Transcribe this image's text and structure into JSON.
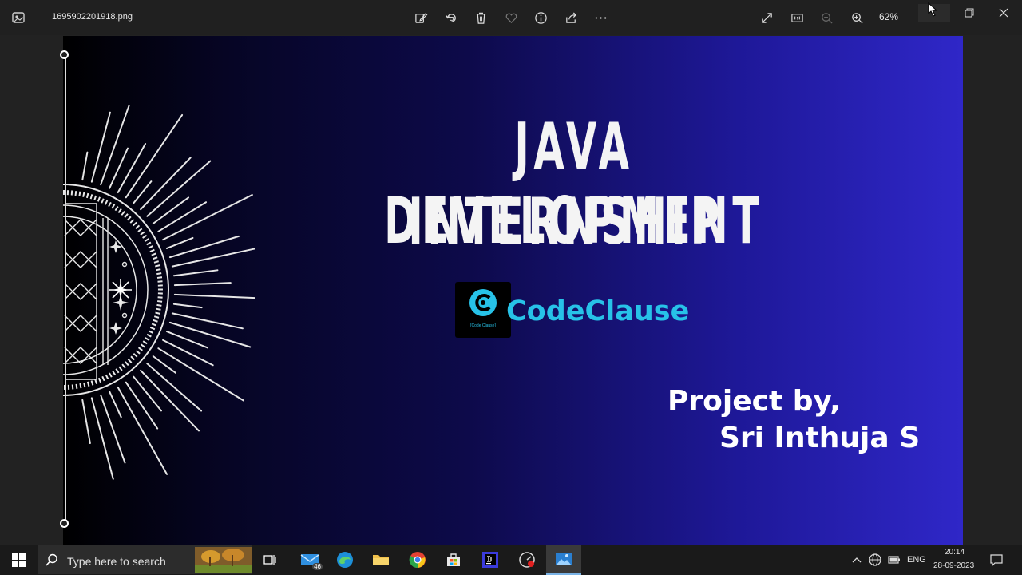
{
  "window": {
    "filename": "1695902201918.png",
    "zoom": "62%",
    "toolbar_icons": [
      "edit-image-icon",
      "rotate-icon",
      "delete-icon",
      "favorite-icon",
      "info-icon",
      "share-icon",
      "more-icon"
    ],
    "view_icons": [
      "fullscreen-icon",
      "actual-size-icon",
      "zoom-out-icon",
      "zoom-in-icon"
    ]
  },
  "slide": {
    "title_line1": "JAVA DEVELOPMENT",
    "title_line2": "INTERNSHIP",
    "logo_name": "CodeClause",
    "logo_caption": "[Code Clause]",
    "project_by": "Project by,",
    "author": "Sri Inthuja S",
    "colors": {
      "brand": "#27c2e8",
      "gradient_start": "#000000",
      "gradient_end": "#2f27c8"
    }
  },
  "taskbar": {
    "search_placeholder": "Type here to search",
    "mail_badge": "46",
    "apps": [
      "task-view-icon",
      "mail-icon",
      "edge-icon",
      "file-explorer-icon",
      "chrome-icon",
      "store-icon",
      "intellij-icon",
      "screen-recorder-icon",
      "photos-icon"
    ],
    "language": "ENG",
    "time": "20:14",
    "date": "28-09-2023"
  }
}
